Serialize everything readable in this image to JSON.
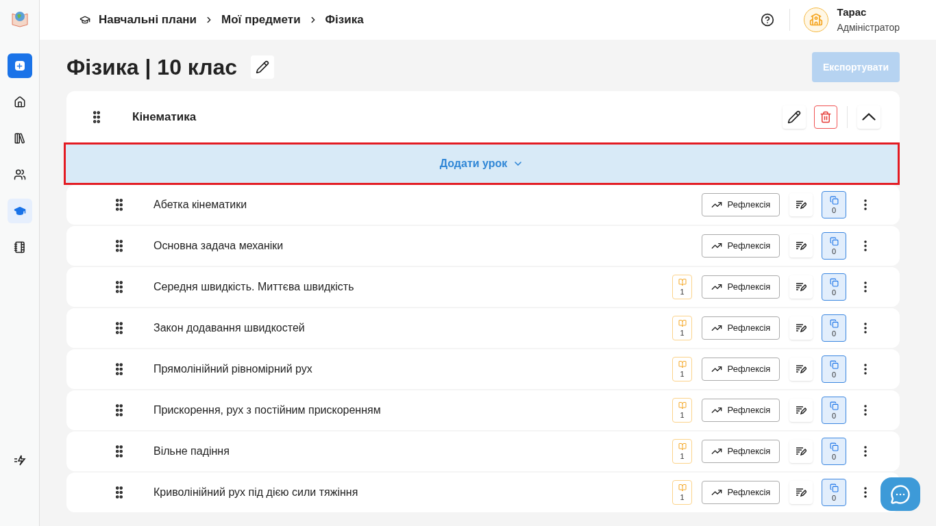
{
  "sidebar": {
    "items": [
      {
        "kind": "add",
        "selected": false
      },
      {
        "kind": "home",
        "selected": false
      },
      {
        "kind": "library",
        "selected": false
      },
      {
        "kind": "users",
        "selected": false
      },
      {
        "kind": "plans",
        "selected": true
      },
      {
        "kind": "journal",
        "selected": false
      }
    ]
  },
  "breadcrumb": [
    "Навчальні плани",
    "Мої предмети",
    "Фізика"
  ],
  "user": {
    "name": "Тарас",
    "role": "Адміністратор"
  },
  "page_title": "Фізика | 10 клас",
  "export_button": {
    "label": "Експортувати",
    "disabled": true
  },
  "module": {
    "title": "Кінематика",
    "expanded": true,
    "add_lesson": {
      "label": "Додати урок",
      "highlighted": true
    },
    "lessons": [
      {
        "title": "Абетка кінематики",
        "reflection": "Рефлексія",
        "tasks": "0"
      },
      {
        "title": "Основна задача механіки",
        "reflection": "Рефлексія",
        "tasks": "0"
      },
      {
        "title": "Середня швидкість. Миттєва швидкість",
        "materials": "1",
        "reflection": "Рефлексія",
        "tasks": "0"
      },
      {
        "title": "Закон додавання швидкостей",
        "materials": "1",
        "reflection": "Рефлексія",
        "tasks": "0"
      },
      {
        "title": "Прямолінійний рівномірний рух",
        "materials": "1",
        "reflection": "Рефлексія",
        "tasks": "0"
      },
      {
        "title": "Прискорення, рух з постійним прискоренням",
        "materials": "1",
        "reflection": "Рефлексія",
        "tasks": "0"
      },
      {
        "title": "Вільне падіння",
        "materials": "1",
        "reflection": "Рефлексія",
        "tasks": "0"
      },
      {
        "title": "Криволінійний рух під дією сили тяжіння",
        "materials": "1",
        "reflection": "Рефлексія",
        "tasks": "0"
      }
    ]
  }
}
